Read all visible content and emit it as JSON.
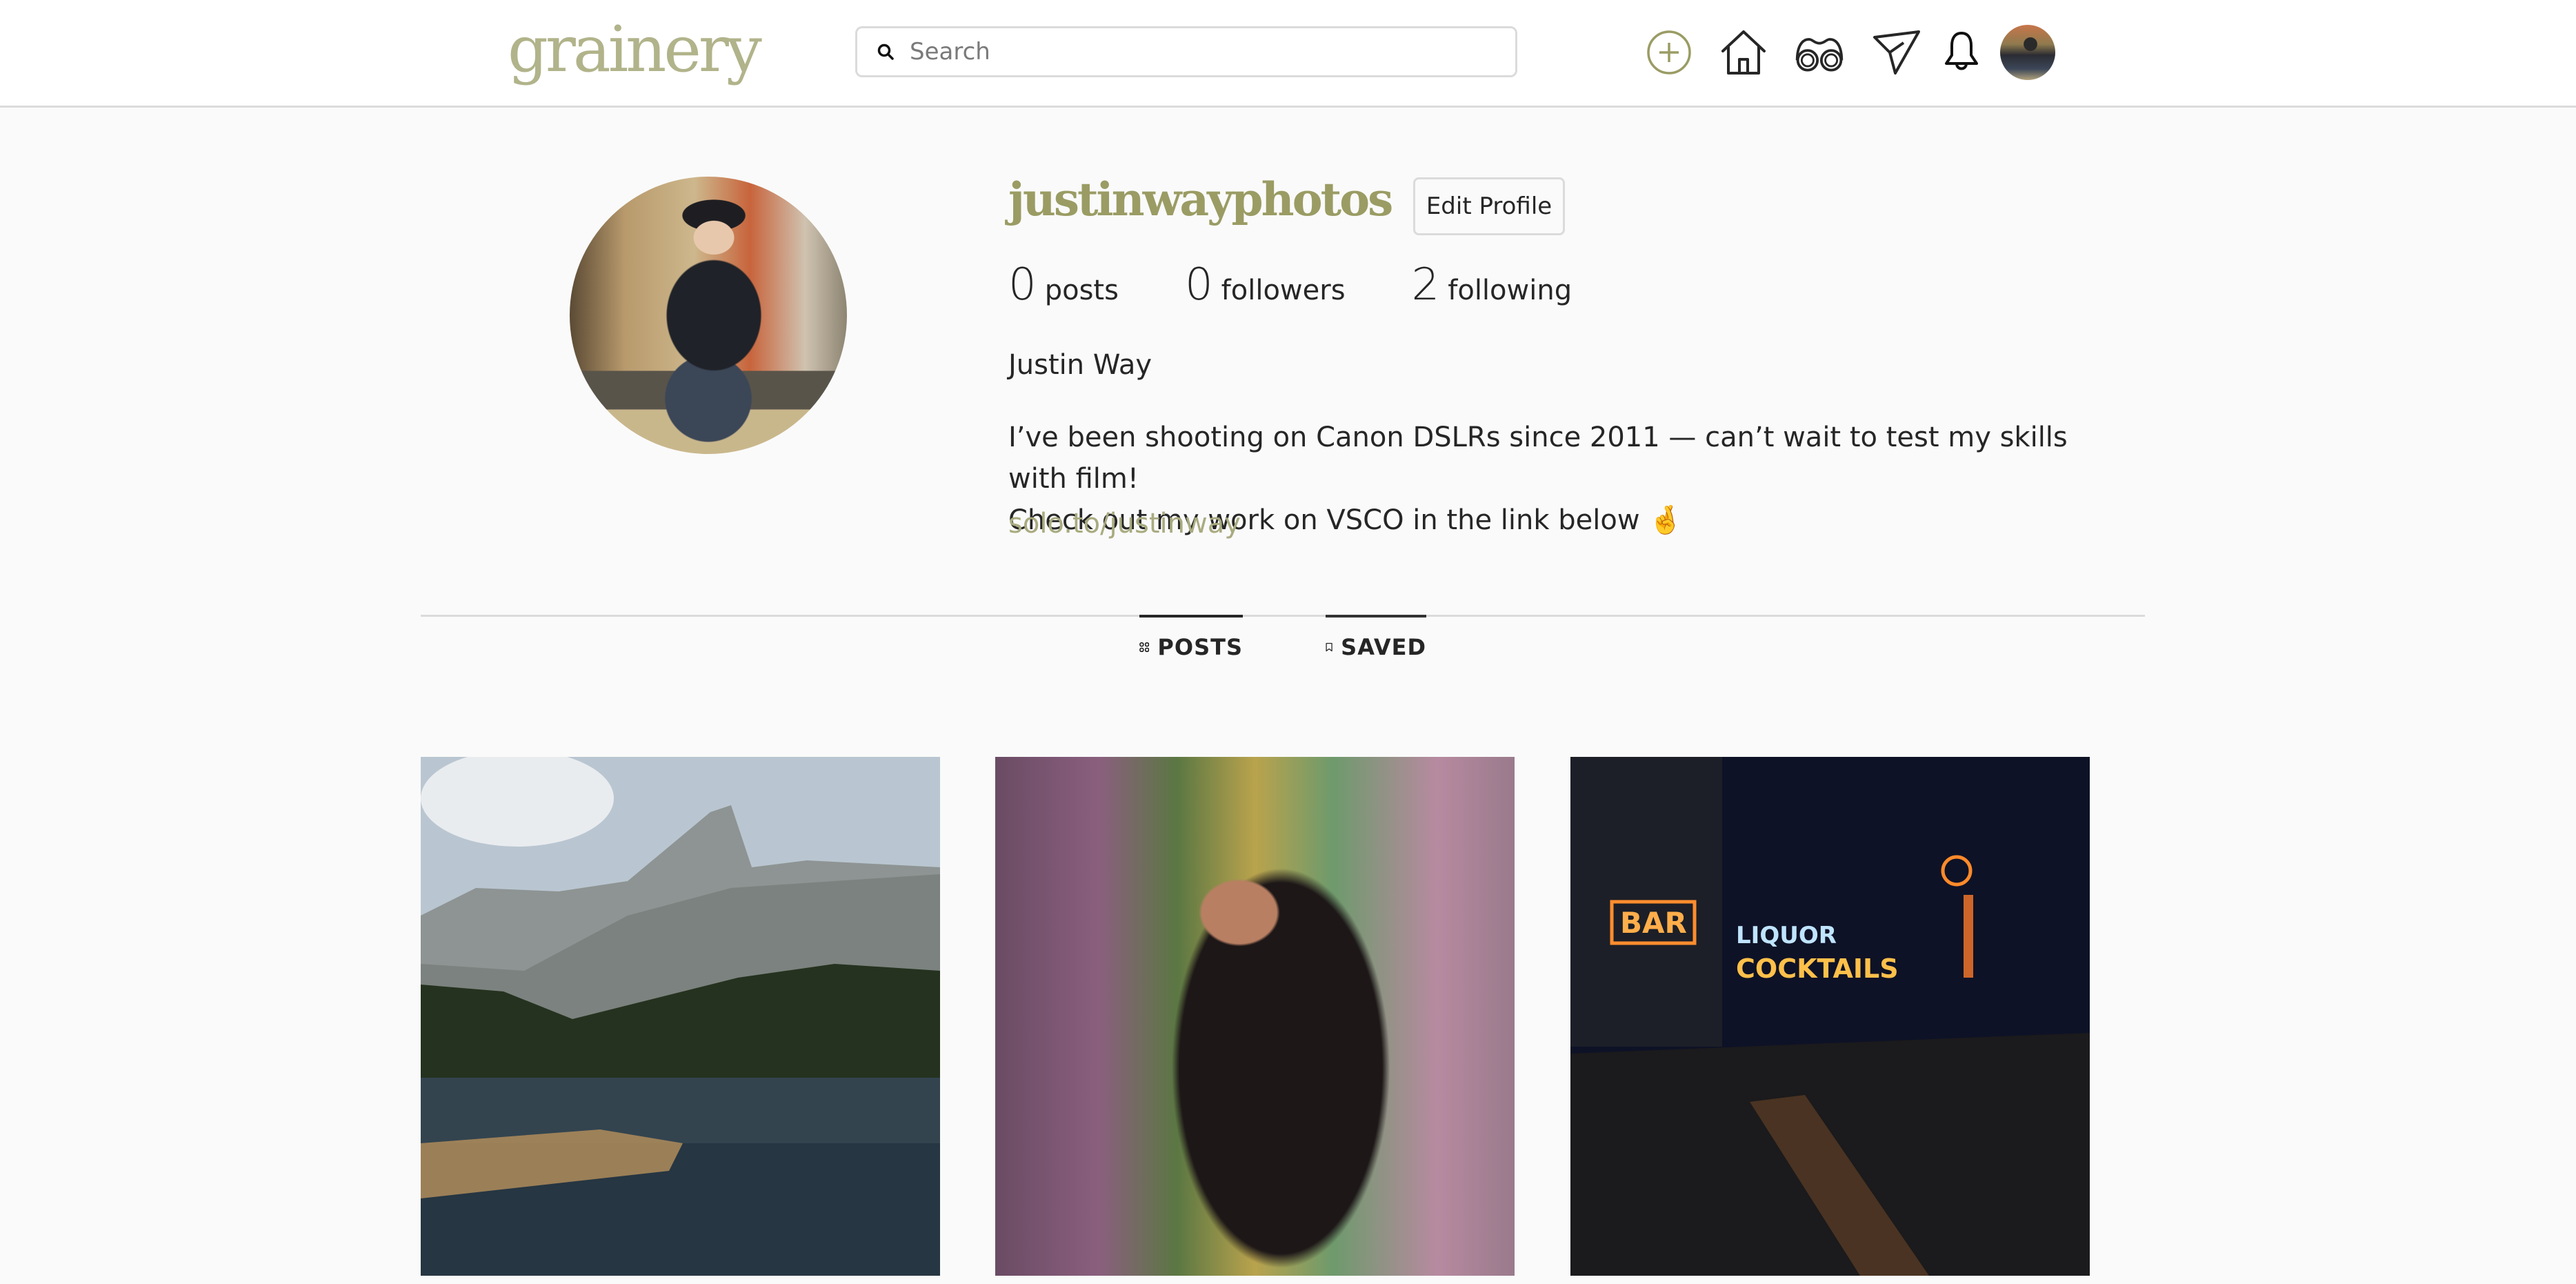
{
  "header": {
    "logo": "grainery",
    "search": {
      "placeholder": "Search",
      "value": ""
    },
    "nav": [
      {
        "name": "create-post",
        "icon": "plus-circle-icon"
      },
      {
        "name": "home",
        "icon": "home-icon"
      },
      {
        "name": "explore",
        "icon": "binoculars-icon"
      },
      {
        "name": "messages",
        "icon": "paper-plane-icon"
      },
      {
        "name": "notifications",
        "icon": "bell-icon"
      },
      {
        "name": "profile",
        "icon": "avatar"
      }
    ]
  },
  "profile": {
    "username": "justinwayphotos",
    "edit_label": "Edit Profile",
    "stats": [
      {
        "value": "0",
        "label": "posts"
      },
      {
        "value": "0",
        "label": "followers"
      },
      {
        "value": "2",
        "label": "following"
      }
    ],
    "full_name": "Justin Way",
    "bio_line1": "I’ve been shooting on Canon DSLRs since 2011 — can’t wait to test my skills with film!",
    "bio_line2": "Check out my work on VSCO in the link below 🤞",
    "link": "solo.to/justinway"
  },
  "tabs": [
    {
      "label": "POSTS",
      "icon": "grid-icon",
      "active": true
    },
    {
      "label": "SAVED",
      "icon": "bookmark-icon",
      "active": false
    }
  ],
  "posts": [
    {
      "description": "Mountain lake with rowboats and granite peak"
    },
    {
      "description": "Woman with long dark hair smiling in front of graffiti wall"
    },
    {
      "description": "Night street with neon BAR and LIQUOR COCKTAILS signs"
    }
  ],
  "colors": {
    "brand": "#9a9c64",
    "logo": "#b1b38a",
    "link": "#a9ab80",
    "background": "#fafafa",
    "border": "#dbdbdb"
  }
}
